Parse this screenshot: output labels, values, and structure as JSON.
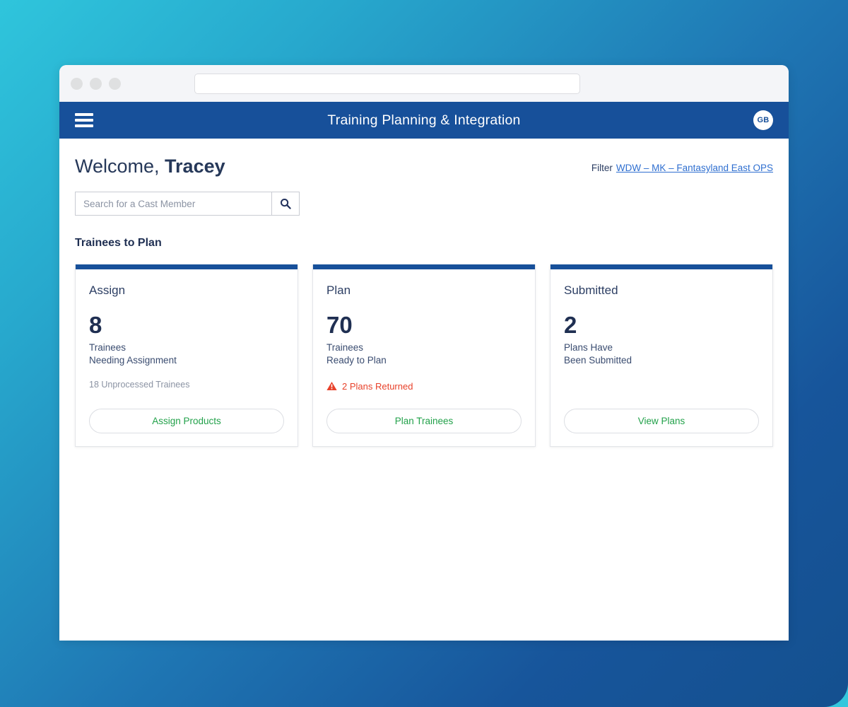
{
  "browser": {
    "traffic_lights": [
      "close",
      "minimize",
      "maximize"
    ],
    "url_value": "",
    "url_placeholder": ""
  },
  "header": {
    "menu_icon": "hamburger-icon",
    "title": "Training Planning & Integration",
    "avatar_initials": "GB"
  },
  "page": {
    "greeting_prefix": "Welcome, ",
    "greeting_name": "Tracey",
    "filter_label": "Filter",
    "filter_value": "WDW – MK – Fantasyland East OPS"
  },
  "search": {
    "value": "",
    "placeholder": "Search for a Cast Member",
    "icon": "search-icon"
  },
  "section": {
    "title": "Trainees to Plan"
  },
  "cards": [
    {
      "heading": "Assign",
      "count": "8",
      "caption_line1": "Trainees",
      "caption_line2": "Needing Assignment",
      "note": "18 Unprocessed Trainees",
      "alert": "",
      "button_label": "Assign Products"
    },
    {
      "heading": "Plan",
      "count": "70",
      "caption_line1": "Trainees",
      "caption_line2": "Ready to Plan",
      "note": "",
      "alert": "2 Plans Returned",
      "alert_icon": "warning-triangle-icon",
      "button_label": "Plan Trainees"
    },
    {
      "heading": "Submitted",
      "count": "2",
      "caption_line1": "Plans Have",
      "caption_line2": "Been Submitted",
      "note": "",
      "alert": "",
      "button_label": "View Plans"
    }
  ],
  "colors": {
    "brand_blue": "#17509a",
    "link_blue": "#2f6fd0",
    "action_green": "#22a14a",
    "alert_red": "#e8412a",
    "text_navy": "#1f2f52",
    "backdrop_cyan": "#33c7dd",
    "backdrop_deep_blue": "#14508f"
  }
}
